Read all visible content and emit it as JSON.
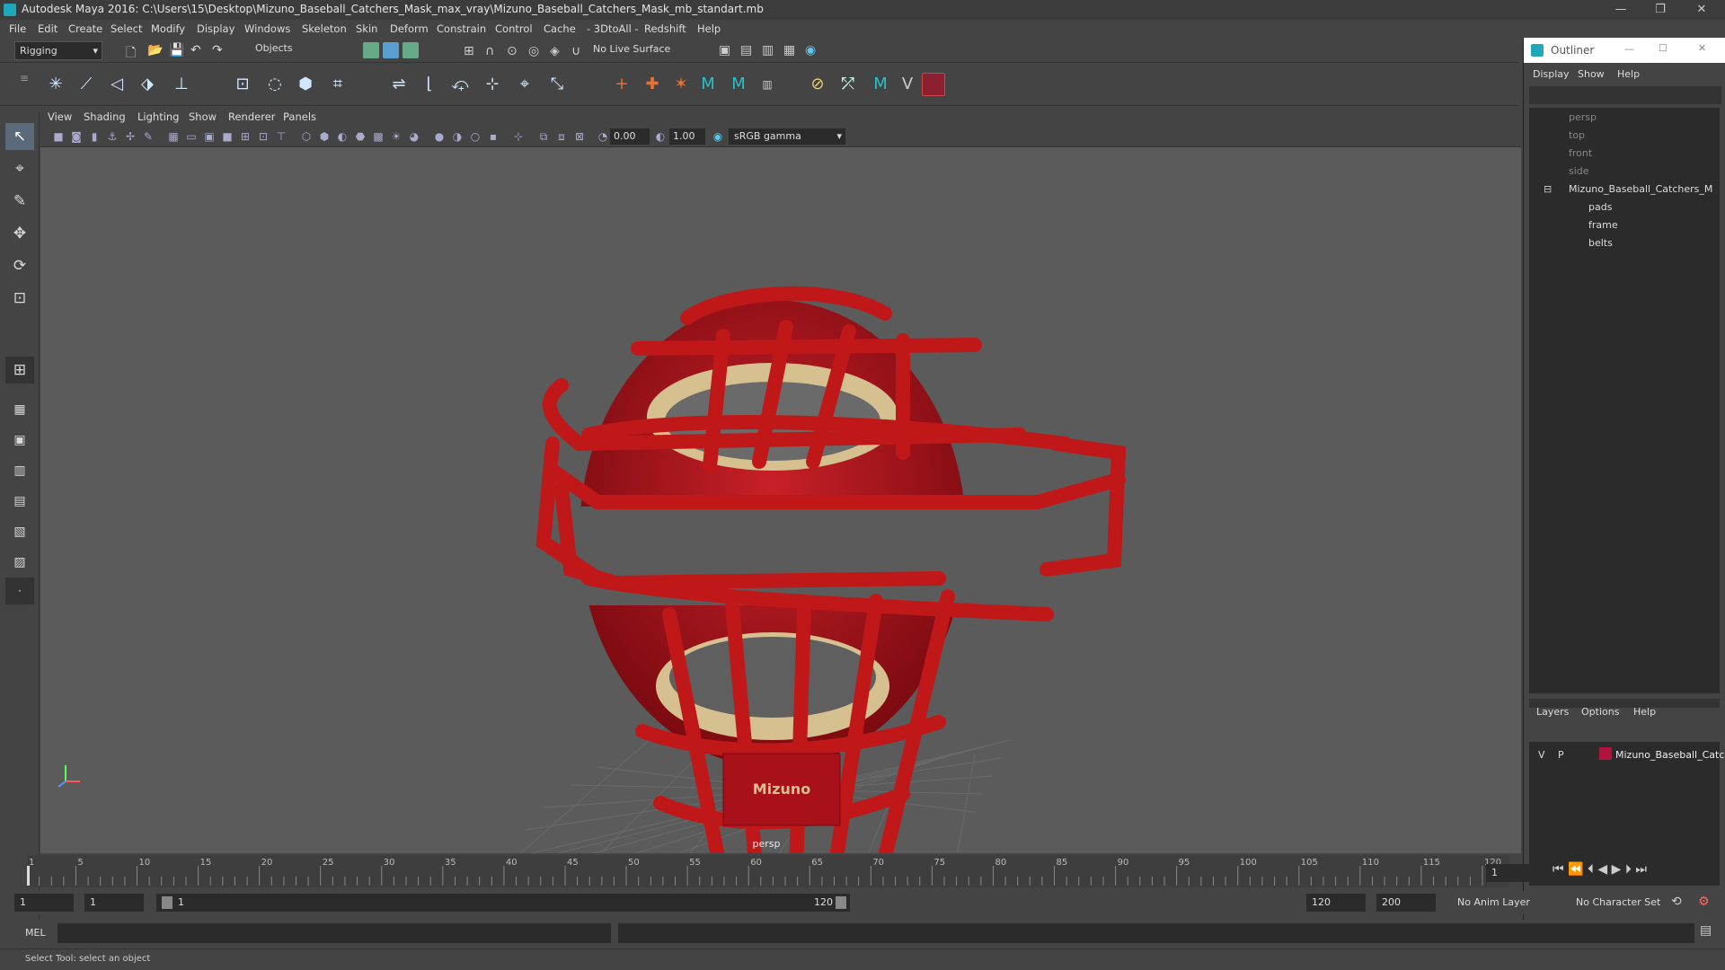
{
  "window": {
    "title": "Autodesk Maya 2016: C:\\Users\\15\\Desktop\\Mizuno_Baseball_Catchers_Mask_max_vray\\Mizuno_Baseball_Catchers_Mask_mb_standart.mb",
    "minimize": "—",
    "restore": "❐",
    "close": "✕"
  },
  "menu": [
    "File",
    "Edit",
    "Create",
    "Select",
    "Modify",
    "Display",
    "Windows",
    "Skeleton",
    "Skin",
    "Deform",
    "Constrain",
    "Control",
    "Cache",
    "- 3DtoAll -",
    "Redshift",
    "Help"
  ],
  "status": {
    "mode": "Rigging",
    "select_mode": "Objects",
    "live_surface": "No Live Surface"
  },
  "viewport": {
    "menu": [
      "View",
      "Shading",
      "Lighting",
      "Show",
      "Renderer",
      "Panels"
    ],
    "exposure": "0.00",
    "gamma": "1.00",
    "color_space": "sRGB gamma",
    "camera_label": "persp",
    "logo_text": "Mizuno"
  },
  "outliner": {
    "title": "Outliner",
    "menu": [
      "Display",
      "Show",
      "Help"
    ],
    "cameras": [
      "persp",
      "top",
      "front",
      "side"
    ],
    "root": "Mizuno_Baseball_Catchers_M",
    "children": [
      "pads",
      "frame",
      "belts"
    ]
  },
  "layers": {
    "menu": [
      "Layers",
      "Options",
      "Help"
    ],
    "v": "V",
    "p": "P",
    "layer_name": "Mizuno_Baseball_Catc",
    "layer_color": "#b0143c"
  },
  "timeline": {
    "ticks": [
      "1",
      "5",
      "10",
      "15",
      "20",
      "25",
      "30",
      "35",
      "40",
      "45",
      "50",
      "55",
      "60",
      "65",
      "70",
      "75",
      "80",
      "85",
      "90",
      "95",
      "100",
      "105",
      "110",
      "115",
      "120"
    ],
    "current_frame": "1"
  },
  "range": {
    "start": "1",
    "start2": "1",
    "slider_start": "1",
    "slider_end": "120",
    "end": "120",
    "end2": "200",
    "anim_layer": "No Anim Layer",
    "char_set": "No Character Set"
  },
  "cmd": {
    "label": "MEL"
  },
  "help": {
    "text": "Select Tool: select an object"
  },
  "colors": {
    "mask_red": "#b3141a",
    "pad_tan": "#d7c08f"
  }
}
